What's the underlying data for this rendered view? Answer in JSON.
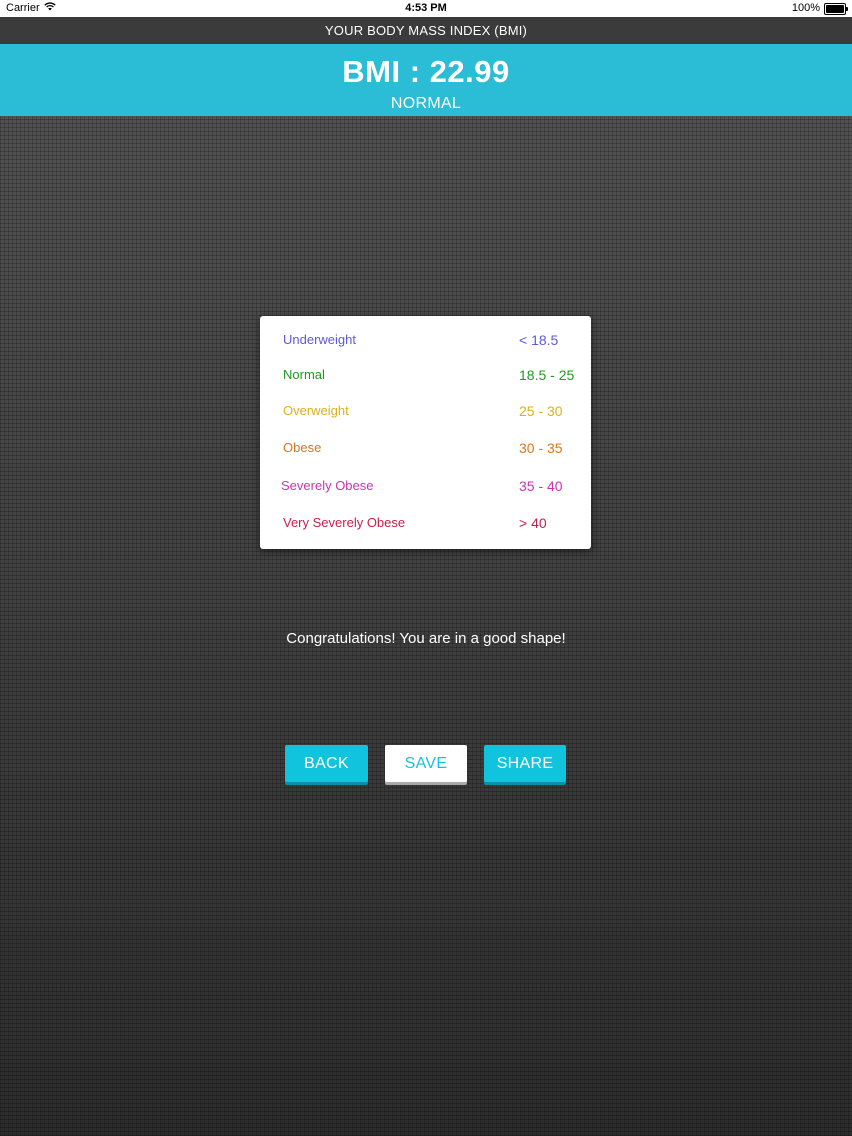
{
  "status_bar": {
    "carrier": "Carrier",
    "time": "4:53 PM",
    "battery": "100%",
    "icons": [
      "wifi-icon",
      "battery-icon"
    ]
  },
  "header": {
    "title": "YOUR BODY MASS INDEX (BMI)"
  },
  "result": {
    "bmi_text": "BMI : 22.99",
    "category": "NORMAL",
    "band_color": "#2bbcd6"
  },
  "legend": {
    "rows": [
      {
        "label": "Underweight",
        "range": "< 18.5",
        "color": "#5b5bd6"
      },
      {
        "label": "Normal",
        "range": "18.5 - 25",
        "color": "#1f9a1f"
      },
      {
        "label": "Overweight",
        "range": "25 - 30",
        "color": "#d9b21a"
      },
      {
        "label": "Obese",
        "range": "30 - 35",
        "color": "#d9761a"
      },
      {
        "label": "Severely Obese",
        "range": "35 - 40",
        "color": "#c934b0"
      },
      {
        "label": "Very Severely Obese",
        "range": "> 40",
        "color": "#c81e4a"
      }
    ]
  },
  "message": "Congratulations! You are in a good shape!",
  "buttons": {
    "back": "BACK",
    "save": "SAVE",
    "share": "SHARE"
  },
  "colors": {
    "accent": "#11c3dc",
    "title_bar": "#3b3b3b"
  }
}
